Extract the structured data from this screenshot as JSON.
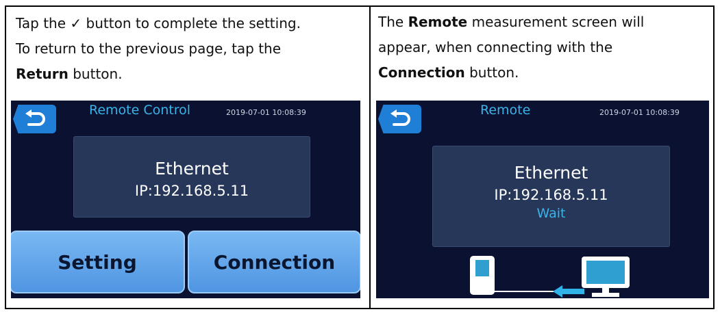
{
  "left": {
    "instruction": {
      "line1_pre": "Tap the ",
      "check_glyph": "✓",
      "line1_post": " button to complete the setting.",
      "line2": "To return to the previous page, tap the",
      "line3_bold": "Return",
      "line3_post": " button."
    },
    "screen": {
      "title": "Remote Control",
      "timestamp": "2019-07-01 10:08:39",
      "info_line1": "Ethernet",
      "info_line2": "IP:192.168.5.11",
      "setting_label": "Setting",
      "connection_label": "Connection",
      "back_icon": "return-arrow-icon"
    }
  },
  "right": {
    "instruction": {
      "line1_pre": "The ",
      "line1_bold": "Remote",
      "line1_post": " measurement screen will",
      "line2": "appear, when connecting with the",
      "line3_bold": "Connection",
      "line3_post": " button."
    },
    "screen": {
      "title": "Remote",
      "timestamp": "2019-07-01 10:08:39",
      "info_line1": "Ethernet",
      "info_line2": "IP:192.168.5.11",
      "info_status": "Wait",
      "back_icon": "return-arrow-icon",
      "device_icon": "handheld-device-icon",
      "monitor_icon": "monitor-icon",
      "link_icon": "arrow-left-icon"
    }
  },
  "colors": {
    "screen_bg": "#0b1130",
    "accent": "#3ab4e8",
    "button_blue": "#1f7fd6",
    "info_box": "#27375a"
  }
}
